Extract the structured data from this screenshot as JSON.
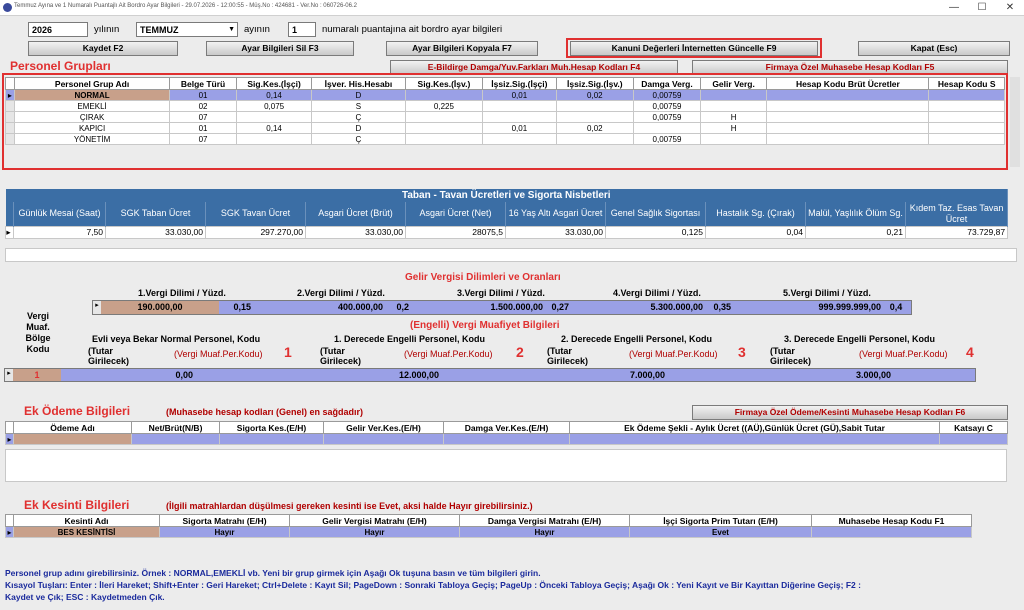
{
  "window": {
    "title": "Temmuz Ayına ve 1 Numaralı Puantajlı Ait Bordro Ayar Bilgileri - 29.07.2026 - 12:00:55 - Müş.No : 424681 - Ver.No : 060726-06.2",
    "minimize": "—",
    "maximize": "☐",
    "close": "✕"
  },
  "header": {
    "year": "2026",
    "year_label": "yılının",
    "month": "TEMMUZ",
    "month_label": "ayının",
    "puantaj": "1",
    "suffix": "numaralı puantajına ait bordro ayar bilgileri"
  },
  "buttons": {
    "save": "Kaydet F2",
    "delete": "Ayar Bilgileri Sil F3",
    "copy": "Ayar Bilgileri Kopyala F7",
    "update": "Kanuni Değerleri İnternetten Güncelle F9",
    "close": "Kapat (Esc)",
    "ebildirge": "E-Bildirge Damga/Yuv.Farkları Muh.Hesap Kodları F4",
    "firm_accounts": "Firmaya Özel Muhasebe Hesap Kodları F5",
    "firm_payment": "Firmaya Özel Ödeme/Kesinti Muhasebe Hesap Kodları F6"
  },
  "personnel": {
    "title": "Personel Grupları",
    "headers": [
      "Personel Grup Adı",
      "Belge Türü",
      "Sig.Kes.(İşçi)",
      "İşver. His.Hesabı",
      "Sig.Kes.(İşv.)",
      "İşsiz.Sig.(İşçi)",
      "İşsiz.Sig.(İşv.)",
      "Damga Verg.",
      "Gelir Verg.",
      "Hesap Kodu Brüt Ücretler",
      "Hesap Kodu S"
    ],
    "rows": [
      [
        "NORMAL",
        "01",
        "0,14",
        "D",
        "",
        "0,01",
        "0,02",
        "0,00759",
        "",
        "",
        ""
      ],
      [
        "EMEKLİ",
        "02",
        "0,075",
        "S",
        "0,225",
        "",
        "",
        "0,00759",
        "",
        "",
        ""
      ],
      [
        "ÇIRAK",
        "07",
        "",
        "Ç",
        "",
        "",
        "",
        "0,00759",
        "H",
        "",
        ""
      ],
      [
        "KAPICI",
        "01",
        "0,14",
        "D",
        "",
        "0,01",
        "0,02",
        "",
        "H",
        "",
        ""
      ],
      [
        "YÖNETİM",
        "07",
        "",
        "Ç",
        "",
        "",
        "",
        "0,00759",
        "",
        "",
        ""
      ]
    ]
  },
  "sgk": {
    "title": "Taban - Tavan Ücretleri ve Sigorta Nisbetleri",
    "headers": [
      "Günlük Mesai (Saat)",
      "SGK Taban Ücret",
      "SGK Tavan Ücret",
      "Asgari Ücret (Brüt)",
      "Asgari Ücret (Net)",
      "16 Yaş Altı Asgari Ücret",
      "Genel Sağlık Sigortası",
      "Hastalık Sg. (Çırak)",
      "Malül, Yaşlılık Ölüm Sg.",
      "Kıdem Taz. Esas Tavan Ücret"
    ],
    "values": [
      "7,50",
      "33.030,00",
      "297.270,00",
      "33.030,00",
      "28075,5",
      "33.030,00",
      "0,125",
      "0,04",
      "0,21",
      "73.729,87"
    ]
  },
  "tax": {
    "title": "Gelir Vergisi Dilimleri ve Oranları",
    "headers": [
      "1.Vergi Dilimi  /  Yüzd.",
      "2.Vergi Dilimi  /  Yüzd.",
      "3.Vergi Dilimi  /  Yüzd.",
      "4.Vergi Dilimi  /  Yüzd.",
      "5.Vergi Dilimi  /  Yüzd."
    ],
    "limits": [
      "190.000,00",
      "400.000,00",
      "1.500.000,00",
      "5.300.000,00",
      "999.999.999,00"
    ],
    "rates": [
      "0,15",
      "0,2",
      "0,27",
      "0,35",
      "0,4"
    ]
  },
  "exemption": {
    "title": "(Engelli) Vergi Muafiyet Bilgileri",
    "code_header": "Vergi Muaf. Bölge Kodu",
    "col_titles": [
      "Evli veya Bekar Normal Personel, Kodu",
      "1. Derecede Engelli Personel, Kodu",
      "2. Derecede Engelli Personel, Kodu",
      "3. Derecede Engelli Personel, Kodu"
    ],
    "tutar": "(Tutar Girilecek)",
    "kod": "(Vergi Muaf.Per.Kodu)",
    "numbers": [
      "1",
      "2",
      "3",
      "4"
    ],
    "code": "1",
    "values": [
      "0,00",
      "12.000,00",
      "7.000,00",
      "3.000,00"
    ]
  },
  "extra_pay": {
    "title": "Ek Ödeme Bilgileri",
    "note": "(Muhasebe hesap kodları (Genel) en sağdadır)",
    "headers": [
      "Ödeme Adı",
      "Net/Brüt(N/B)",
      "Sigorta Kes.(E/H)",
      "Gelir Ver.Kes.(E/H)",
      "Damga Ver.Kes.(E/H)",
      "Ek Ödeme Şekli - Aylık Ücret ((AÜ),Günlük Ücret (GÜ),Sabit Tutar",
      "Katsayı C"
    ]
  },
  "deduction": {
    "title": "Ek Kesinti Bilgileri",
    "note": "(İlgili matrahlardan düşülmesi gereken kesinti ise Evet, aksi halde Hayır girebilirsiniz.)",
    "headers": [
      "Kesinti Adı",
      "Sigorta Matrahı (E/H)",
      "Gelir Vergisi Matrahı (E/H)",
      "Damga Vergisi Matrahı (E/H)",
      "İşçi Sigorta Prim Tutarı (E/H)",
      "Muhasebe Hesap Kodu F1"
    ],
    "row": [
      "BES KESİNTİSİ",
      "Hayır",
      "Hayır",
      "Hayır",
      "Evet",
      ""
    ]
  },
  "footer": {
    "line1": "Personel grup adını girebilirsiniz. Örnek : NORMAL,EMEKLİ vb. Yeni bir grup girmek için Aşağı Ok tuşuna basın ve tüm bilgileri girin.",
    "line2": "Kısayol Tuşları: Enter : İleri Hareket; Shift+Enter : Geri Hareket; Ctrl+Delete : Kayıt Sil; PageDown : Sonraki Tabloya Geçiş; PageUp : Önceki Tabloya Geçiş; Aşağı Ok : Yeni Kayıt ve Bir Kayıttan Diğerine Geçiş; F2 :",
    "line3": "Kaydet ve Çık; ESC : Kaydetmeden Çık."
  },
  "colors": {
    "accent_red": "#e03030",
    "header_blue": "#3b6ea5",
    "row_selected": "#9aa0e6"
  }
}
